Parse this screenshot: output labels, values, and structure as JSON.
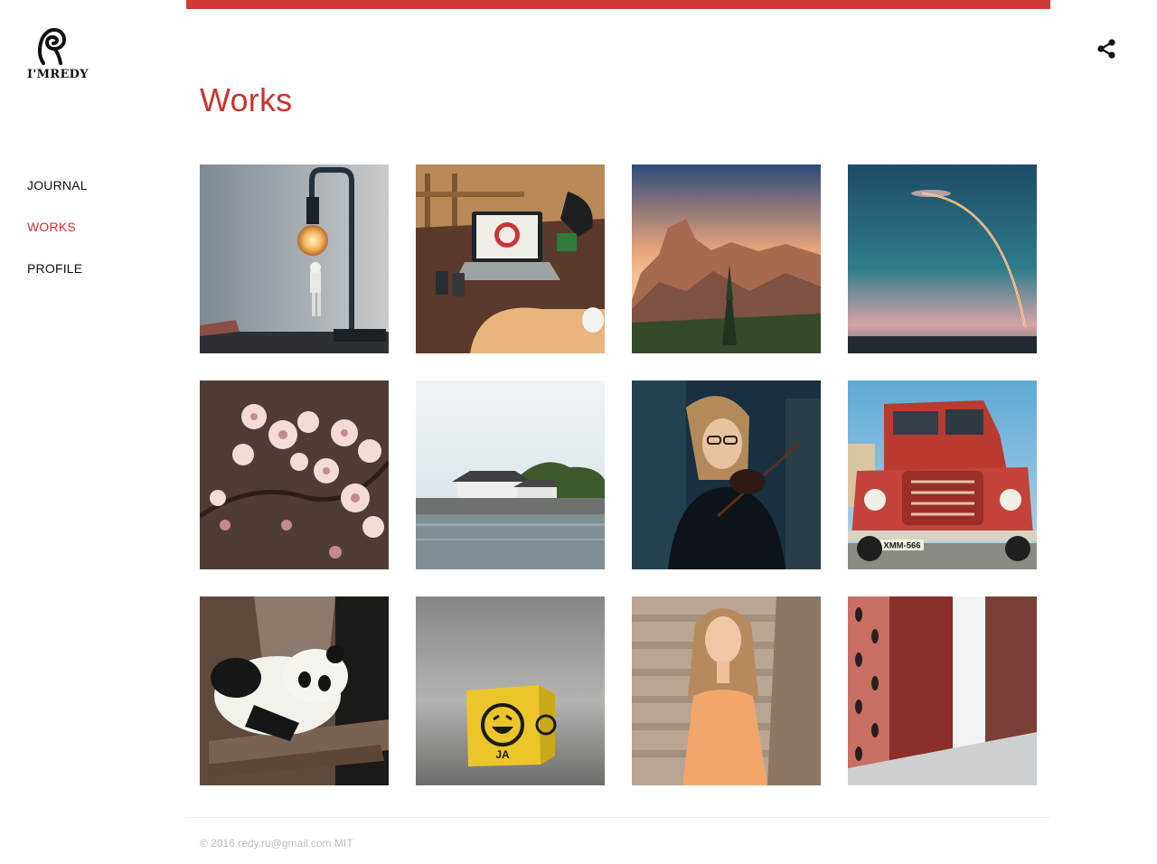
{
  "brand": {
    "logo_text": "I'MREDY"
  },
  "nav": {
    "items": [
      {
        "label": "JOURNAL",
        "active": false
      },
      {
        "label": "WORKS",
        "active": true
      },
      {
        "label": "PROFILE",
        "active": false
      }
    ]
  },
  "header": {
    "share_icon": "share-icon"
  },
  "main": {
    "title": "Works",
    "dice_text": "JA",
    "license_plate": "XMM-566"
  },
  "footer": {
    "text": "© 2016 redy.ru@gmail.com MIT"
  },
  "colors": {
    "accent": "#d13a36",
    "title": "#c8352f",
    "footer": "#bdbdbd"
  }
}
